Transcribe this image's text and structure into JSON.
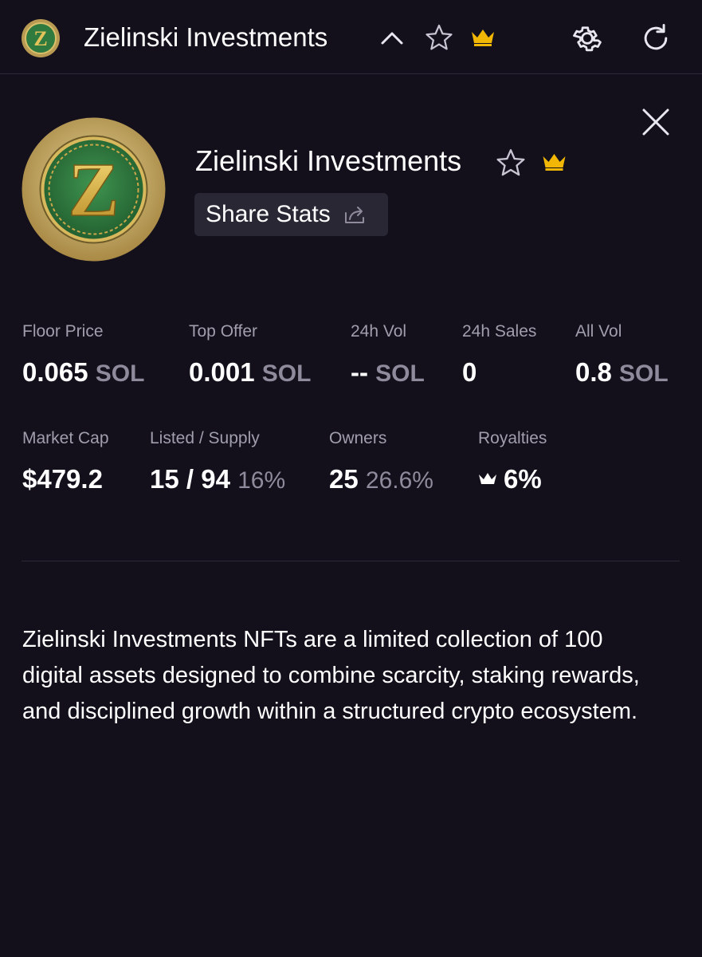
{
  "header": {
    "title": "Zielinski Investments",
    "icons": [
      "collection-logo-icon",
      "chevron-up-icon",
      "star-outline-icon",
      "crown-icon",
      "gear-icon",
      "refresh-icon"
    ]
  },
  "collection": {
    "name": "Zielinski Investments",
    "share_label": "Share Stats",
    "logo_letter": "Z"
  },
  "stats_row1": [
    {
      "label": "Floor Price",
      "value": "0.065",
      "unit": "SOL"
    },
    {
      "label": "Top Offer",
      "value": "0.001",
      "unit": "SOL"
    },
    {
      "label": "24h Vol",
      "value": "--",
      "unit": "SOL"
    },
    {
      "label": "24h Sales",
      "value": "0",
      "unit": ""
    },
    {
      "label": "All Vol",
      "value": "0.8",
      "unit": "SOL"
    }
  ],
  "stats_row2": [
    {
      "label": "Market Cap",
      "value": "$479.2",
      "extra": ""
    },
    {
      "label": "Listed / Supply",
      "value": "15 / 94",
      "extra": "16%"
    },
    {
      "label": "Owners",
      "value": "25",
      "extra": "26.6%"
    },
    {
      "label": "Royalties",
      "value": "6%",
      "extra": ""
    }
  ],
  "description": "Zielinski Investments NFTs are a limited collection of 100 digital assets designed to combine scarcity, staking rewards, and disciplined growth within a structured crypto ecosystem.",
  "colors": {
    "background": "#13101b",
    "accent_gold": "#f2b705",
    "muted_text": "#8f8b9c",
    "button_bg": "#2a2735",
    "logo_green": "#2f7a3e"
  }
}
